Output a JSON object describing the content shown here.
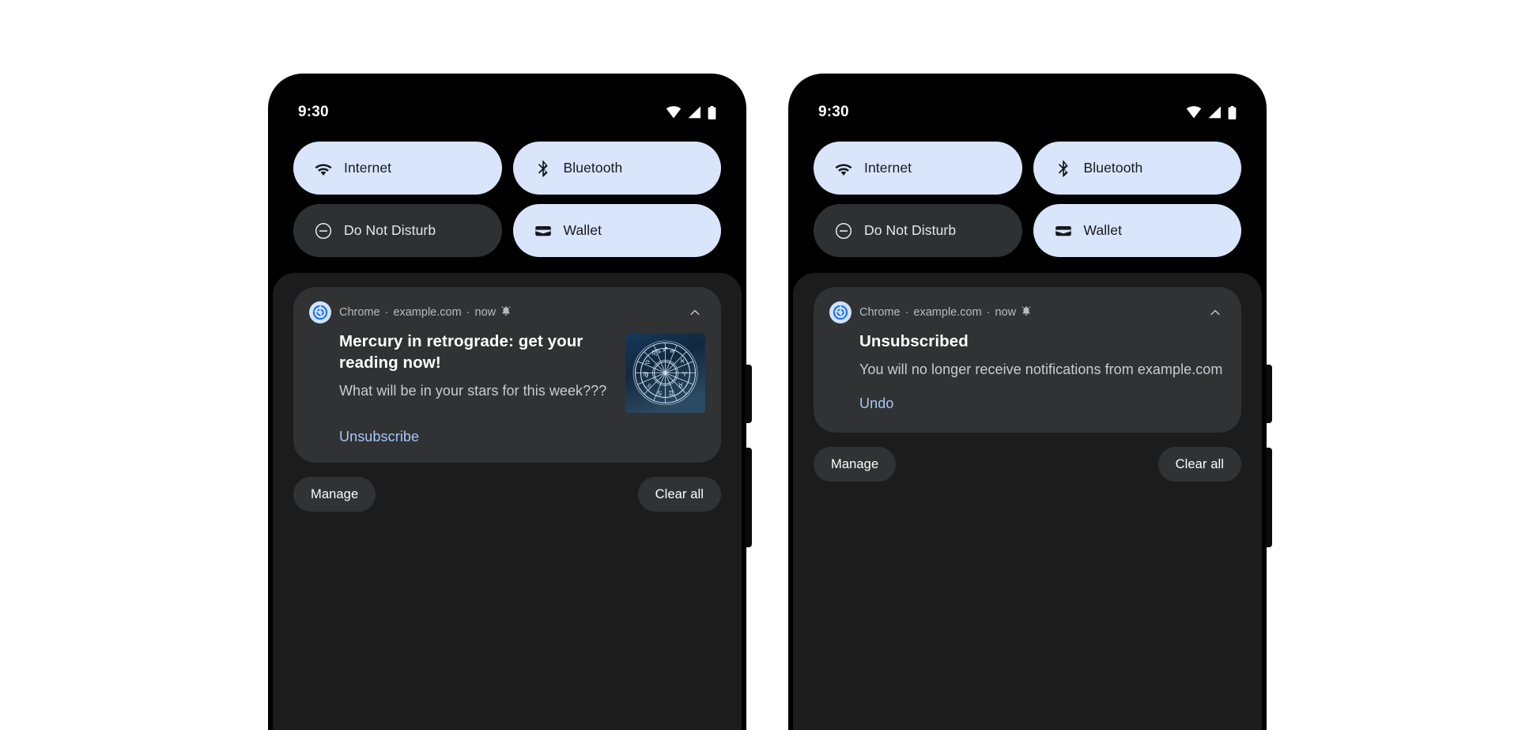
{
  "phones": [
    {
      "id": "phone-before",
      "status_bar": {
        "time": "9:30",
        "icons": [
          "wifi-icon",
          "cellular-signal-icon",
          "battery-icon"
        ]
      },
      "quick_settings": [
        {
          "label": "Internet",
          "icon": "wifi-icon",
          "state": "on"
        },
        {
          "label": "Bluetooth",
          "icon": "bluetooth-icon",
          "state": "on"
        },
        {
          "label": "Do Not Disturb",
          "icon": "do-not-disturb-icon",
          "state": "off"
        },
        {
          "label": "Wallet",
          "icon": "wallet-icon",
          "state": "on"
        }
      ],
      "notification": {
        "app_name": "Chrome",
        "source": "example.com",
        "time": "now",
        "separator": "·",
        "alert_icon": "bell-icon",
        "collapse_icon": "chevron-up-icon",
        "title": "Mercury in retrograde: get your reading now!",
        "body": "What will be in your stars for this week???",
        "action_label": "Unsubscribe",
        "thumbnail": "zodiac-wheel-image"
      },
      "shade_buttons": {
        "manage": "Manage",
        "clear_all": "Clear all"
      }
    },
    {
      "id": "phone-after",
      "status_bar": {
        "time": "9:30",
        "icons": [
          "wifi-icon",
          "cellular-signal-icon",
          "battery-icon"
        ]
      },
      "quick_settings": [
        {
          "label": "Internet",
          "icon": "wifi-icon",
          "state": "on"
        },
        {
          "label": "Bluetooth",
          "icon": "bluetooth-icon",
          "state": "on"
        },
        {
          "label": "Do Not Disturb",
          "icon": "do-not-disturb-icon",
          "state": "off"
        },
        {
          "label": "Wallet",
          "icon": "wallet-icon",
          "state": "on"
        }
      ],
      "notification": {
        "app_name": "Chrome",
        "source": "example.com",
        "time": "now",
        "separator": "·",
        "alert_icon": "bell-icon",
        "collapse_icon": "chevron-up-icon",
        "title": "Unsubscribed",
        "body": "You will no longer receive notifications from example.com",
        "action_label": "Undo",
        "thumbnail": null
      },
      "shade_buttons": {
        "manage": "Manage",
        "clear_all": "Clear all"
      }
    }
  ],
  "colors": {
    "tile_on_bg": "#d9e5fb",
    "tile_off_bg": "#2e3133",
    "shade_bg": "#1c1c1c",
    "card_bg": "#303234",
    "link": "#a8c7fa",
    "page_bg": "#ffffff",
    "frame": "#000000"
  }
}
